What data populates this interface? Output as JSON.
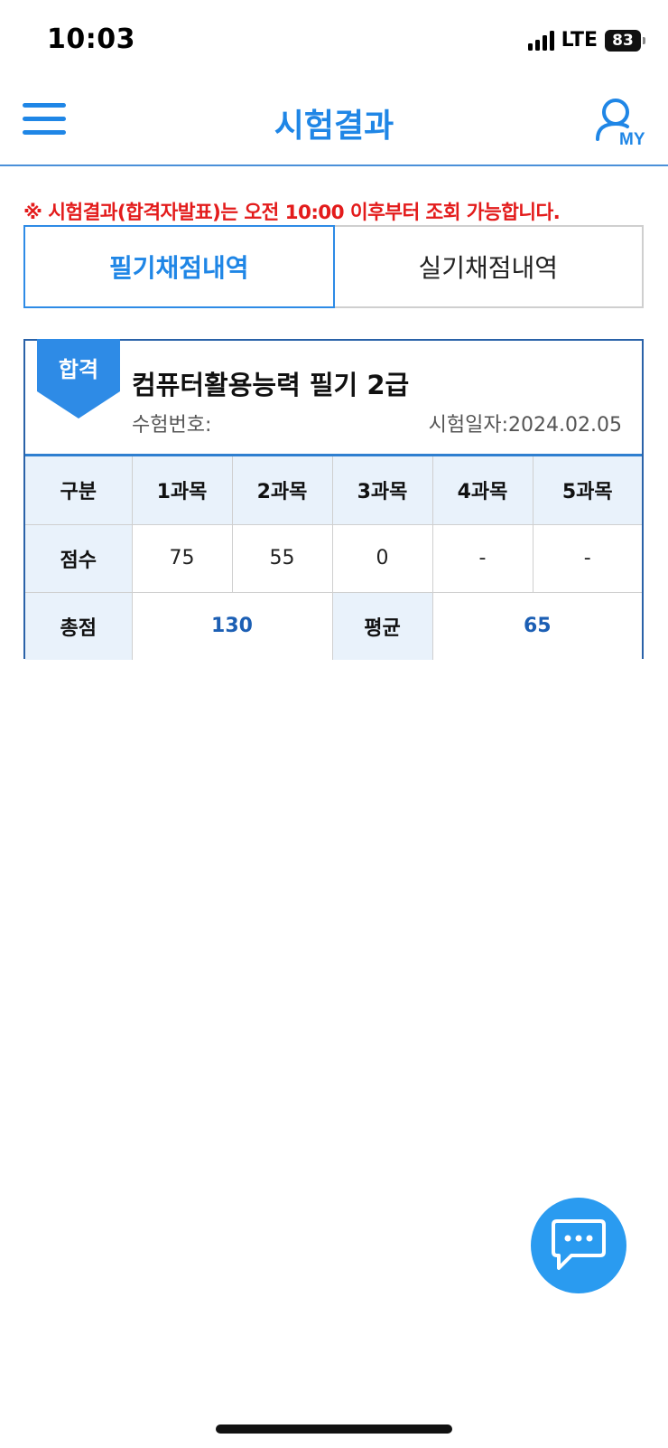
{
  "status_bar": {
    "time": "10:03",
    "network": "LTE",
    "battery": "83"
  },
  "header": {
    "title": "시험결과",
    "menu_icon": "hamburger-menu-icon",
    "my_label": "MY",
    "my_icon": "user-icon"
  },
  "notice": {
    "mark": "※",
    "text_before": "시험결과(합격자발표)는 오전 ",
    "time": "10:00",
    "text_after": " 이후부터 조회 가능합니다."
  },
  "tabs": [
    {
      "label": "필기채점내역",
      "active": true
    },
    {
      "label": "실기채점내역",
      "active": false
    }
  ],
  "result": {
    "badge": "합격",
    "exam_name": "컴퓨터활용능력 필기 2급",
    "exam_number_label": "수험번호:",
    "exam_date_label": "시험일자:",
    "exam_date": "2024.02.05",
    "table": {
      "header": [
        "구분",
        "1과목",
        "2과목",
        "3과목",
        "4과목",
        "5과목"
      ],
      "score_label": "점수",
      "scores": [
        "75",
        "55",
        "0",
        "-",
        "-"
      ],
      "total_label": "총점",
      "total": "130",
      "average_label": "평균",
      "average": "65"
    }
  },
  "colors": {
    "primary": "#1f86e6",
    "notice_red": "#e31b1b",
    "table_header_bg": "#e9f2fb",
    "accent_value": "#1c5fb4",
    "fab": "#2a9bf0"
  },
  "chat_button": {
    "icon": "chat-bubble-icon"
  }
}
